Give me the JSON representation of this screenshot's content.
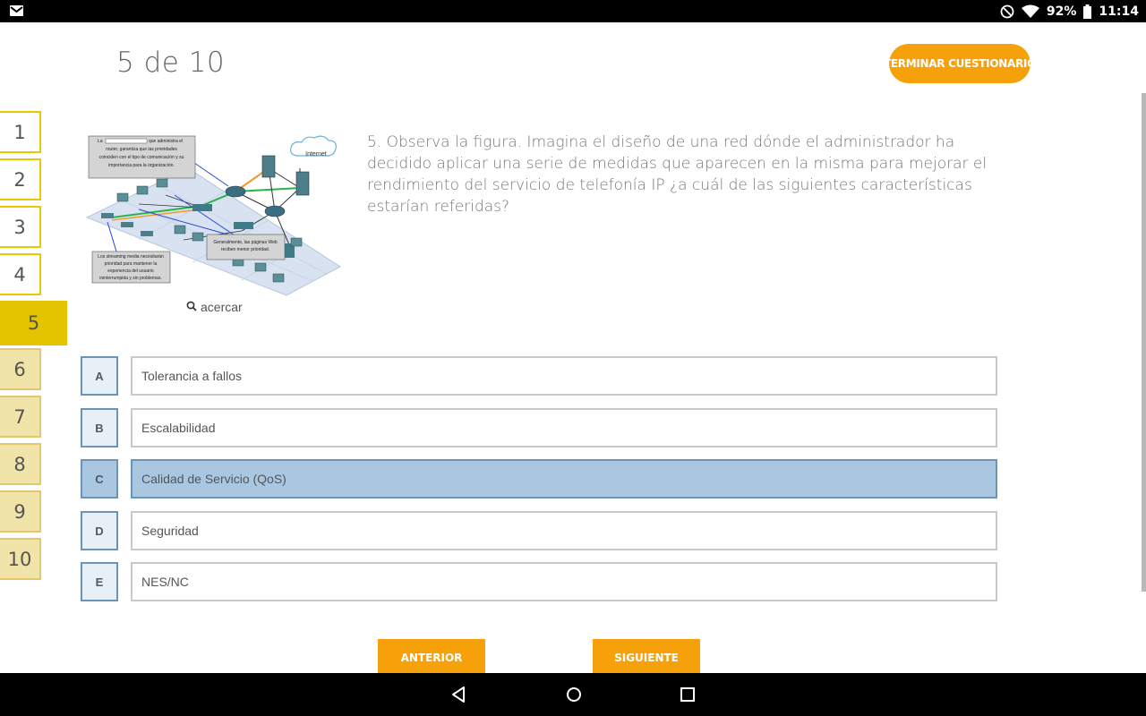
{
  "status_bar": {
    "battery": "92%",
    "time": "11:14",
    "icons": [
      "mail-icon",
      "do-not-disturb-icon",
      "wifi-icon",
      "battery-icon"
    ]
  },
  "header": {
    "progress": "5 de 10",
    "finish_label": "TERMINAR CUESTIONARIO"
  },
  "question_nav": {
    "items": [
      "1",
      "2",
      "3",
      "4",
      "5",
      "6",
      "7",
      "8",
      "9",
      "10"
    ],
    "current": "5"
  },
  "figure": {
    "zoom_label": "acercar",
    "callouts": {
      "top": [
        "La",
        "que administra el",
        "router, garantiza que las prioridades",
        "coinciden con el tipo de comunicación y su",
        "importancia para la organización."
      ],
      "middle": [
        "Generalmente, las páginas Web",
        "reciben menor prioridad."
      ],
      "bottom": [
        "Los streaming media necesitarán",
        "prioridad para mantener la",
        "experiencia del usuario",
        "ininterrumpida y sin problemas."
      ],
      "cloud": "Internet"
    }
  },
  "question": {
    "text": "5. Observa la figura. Imagina el diseño de una red dónde el administrador ha decidido aplicar una serie de medidas que aparecen en la misma para mejorar el rendimiento del servicio de telefonía IP ¿a cuál de las siguientes características estarían referidas?"
  },
  "options": [
    {
      "letter": "A",
      "text": "Tolerancia a fallos"
    },
    {
      "letter": "B",
      "text": "Escalabilidad"
    },
    {
      "letter": "C",
      "text": "Calidad de Servicio (QoS)"
    },
    {
      "letter": "D",
      "text": "Seguridad"
    },
    {
      "letter": "E",
      "text": "NES/NC"
    }
  ],
  "selected_option": "C",
  "footer": {
    "prev_label": "ANTERIOR",
    "next_label": "SIGUIENTE"
  },
  "colors": {
    "accent": "#f7a10a",
    "nav_current": "#e4c400",
    "selected": "#a9c7e0"
  }
}
